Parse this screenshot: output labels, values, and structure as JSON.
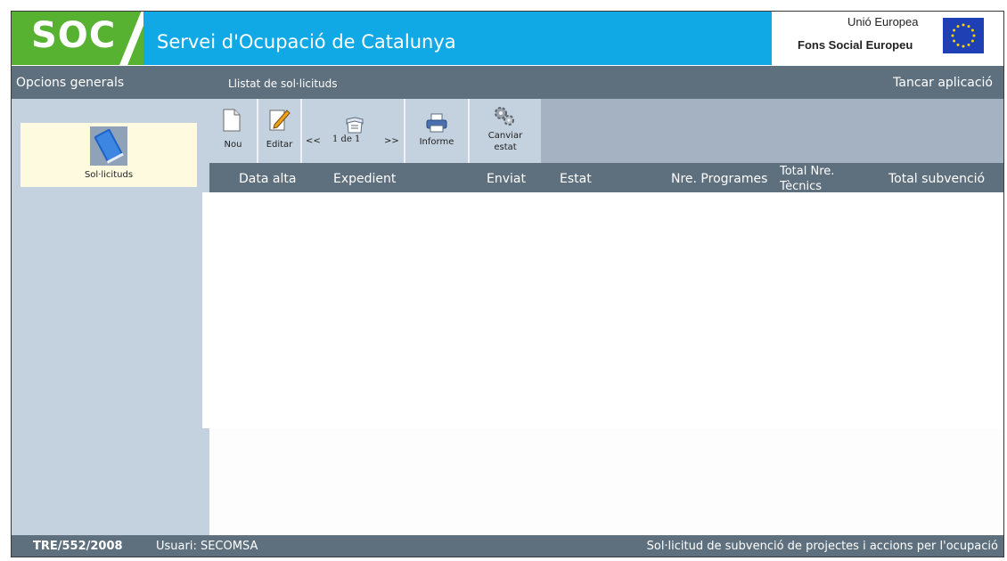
{
  "header": {
    "logo": "SOC",
    "title": "Servei d'Ocupació de Catalunya",
    "eu_line1": "Unió Europea",
    "eu_line2": "Fons Social Europeu"
  },
  "menubar": {
    "left": "Opcions generals",
    "middle": "Llistat de sol·licituds",
    "right": "Tancar aplicació"
  },
  "sidebar": {
    "items": [
      {
        "label": "Sol·licituds",
        "icon": "book-icon"
      }
    ]
  },
  "toolbar": {
    "new_label": "Nou",
    "edit_label": "Editar",
    "prev": "<<",
    "page": "1 de 1",
    "next": ">>",
    "report_label": "Informe",
    "change_state_line1": "Canviar",
    "change_state_line2": "estat"
  },
  "table": {
    "columns": [
      "Data alta",
      "Expedient",
      "Enviat",
      "Estat",
      "Nre. Programes",
      "Total Nre.",
      "Tècnics",
      "Total subvenció"
    ]
  },
  "footer": {
    "code": "TRE/552/2008",
    "user": "Usuari: SECOMSA",
    "description": "Sol·licitud de subvenció de projectes i accions per l'ocupació"
  },
  "colors": {
    "brand_green": "#57b232",
    "brand_blue": "#10a9e6",
    "bar_gray": "#5e6f7d",
    "sidebar": "#c4d1de"
  }
}
